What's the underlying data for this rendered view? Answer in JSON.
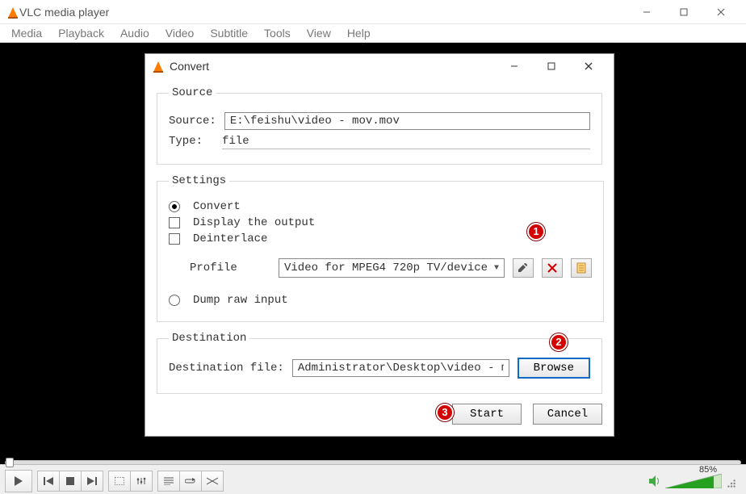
{
  "main_window": {
    "title": "VLC media player",
    "menu": [
      "Media",
      "Playback",
      "Audio",
      "Video",
      "Subtitle",
      "Tools",
      "View",
      "Help"
    ]
  },
  "dialog": {
    "title": "Convert",
    "source": {
      "legend": "Source",
      "source_label": "Source:",
      "source_value": "E:\\feishu\\video - mov.mov",
      "type_label": "Type:",
      "type_value": "file"
    },
    "settings": {
      "legend": "Settings",
      "convert_label": "Convert",
      "display_output_label": "Display the output",
      "deinterlace_label": "Deinterlace",
      "profile_label": "Profile",
      "profile_value": "Video for MPEG4 720p TV/device",
      "dump_raw_label": "Dump raw input"
    },
    "destination": {
      "legend": "Destination",
      "file_label": "Destination file:",
      "file_value": "Administrator\\Desktop\\video - mov.mov",
      "browse_label": "Browse"
    },
    "actions": {
      "start": "Start",
      "cancel": "Cancel"
    }
  },
  "playback": {
    "volume_percent": "85%"
  },
  "annotations": {
    "one": "1",
    "two": "2",
    "three": "3"
  },
  "colors": {
    "accent_blue": "#1169c9",
    "badge_red": "#d40000",
    "vlc_orange": "#ff7d00"
  }
}
